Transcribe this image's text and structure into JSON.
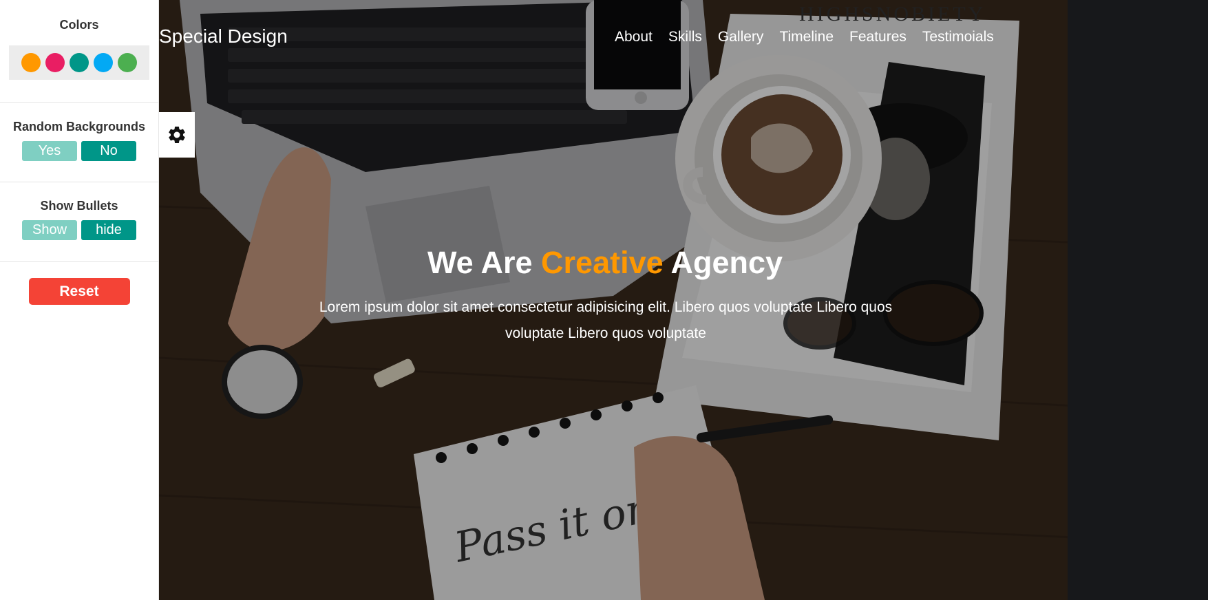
{
  "settings": {
    "colors_title": "Colors",
    "colors": [
      "#ff9800",
      "#e91e63",
      "#009688",
      "#03a9f4",
      "#4caf50"
    ],
    "backgrounds_title": "Random Backgrounds",
    "backgrounds_yes": "Yes",
    "backgrounds_no": "No",
    "bullets_title": "Show Bullets",
    "bullets_show": "Show",
    "bullets_hide": "hide",
    "reset_label": "Reset"
  },
  "header": {
    "brand": "Special Design",
    "nav": [
      "About",
      "Skills",
      "Gallery",
      "Timeline",
      "Features",
      "Testimoials"
    ]
  },
  "hero": {
    "title_before": "We Are ",
    "title_accent": "Creative",
    "title_after": " Agency",
    "description": "Lorem ipsum dolor sit amet consectetur adipisicing elit. Libero quos voluptate Libero quos voluptate Libero quos voluptate",
    "accent_color": "#ff9800"
  },
  "icons": {
    "settings_toggle": "gear-icon"
  }
}
